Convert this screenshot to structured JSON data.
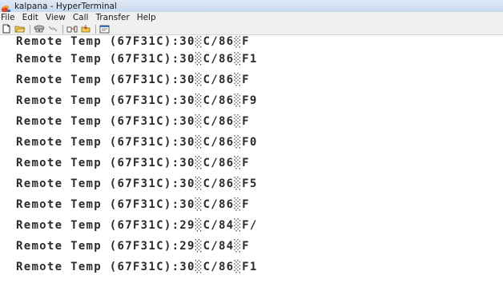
{
  "window": {
    "title": "kalpana - HyperTerminal"
  },
  "menubar": {
    "items": [
      {
        "label": "File"
      },
      {
        "label": "Edit"
      },
      {
        "label": "View"
      },
      {
        "label": "Call"
      },
      {
        "label": "Transfer"
      },
      {
        "label": "Help"
      }
    ]
  },
  "toolbar": {
    "buttons": [
      {
        "icon": "new-document-icon"
      },
      {
        "icon": "open-folder-icon"
      },
      {
        "icon": "connect-phone-icon"
      },
      {
        "icon": "disconnect-icon"
      },
      {
        "icon": "send-file-icon"
      },
      {
        "icon": "receive-file-icon"
      },
      {
        "icon": "properties-icon"
      }
    ]
  },
  "terminal": {
    "lines": [
      "Remote Temp (67F31C):30░C/86░F",
      "Remote Temp (67F31C):30░C/86░F1",
      "Remote Temp (67F31C):30░C/86░F",
      "Remote Temp (67F31C):30░C/86░F9",
      "Remote Temp (67F31C):30░C/86░F",
      "Remote Temp (67F31C):30░C/86░F0",
      "Remote Temp (67F31C):30░C/86░F",
      "Remote Temp (67F31C):30░C/86░F5",
      "Remote Temp (67F31C):30░C/86░F",
      "Remote Temp (67F31C):29░C/84░F/",
      "Remote Temp (67F31C):29░C/84░F",
      "Remote Temp (67F31C):30░C/86░F1"
    ]
  },
  "colors": {
    "titlebar": "#c9daee",
    "menubar": "#f0f0f0",
    "terminal_text": "#2a2a2a",
    "terminal_bg": "#ffffff"
  }
}
